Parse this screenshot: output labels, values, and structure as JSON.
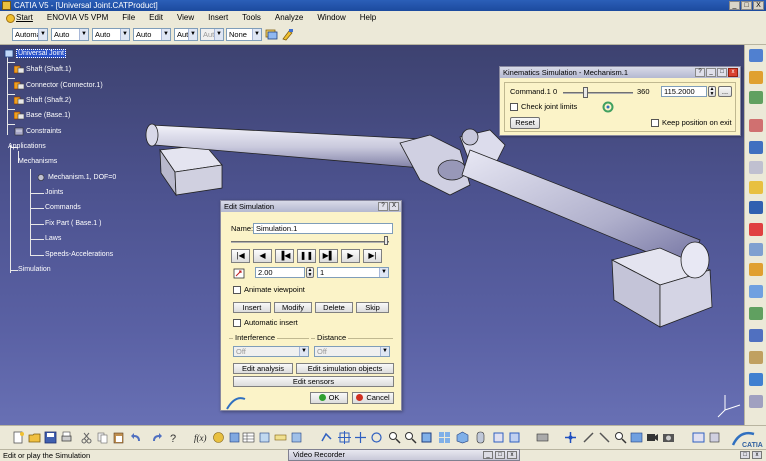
{
  "window": {
    "title": "CATIA V5 - [Universal Joint.CATProduct]",
    "minimize": "_",
    "maximize": "□",
    "close": "X"
  },
  "menu": [
    "Start",
    "ENOVIA V5 VPM",
    "File",
    "Edit",
    "View",
    "Insert",
    "Tools",
    "Analyze",
    "Window",
    "Help"
  ],
  "properties_toolbar": {
    "combos": [
      "Automa",
      "Auto",
      "Auto",
      "Auto",
      "Aut",
      "Aut",
      "None"
    ]
  },
  "tree": {
    "root": "Universal Joint",
    "parts": [
      "Shaft (Shaft.1)",
      "Connector (Connector.1)",
      "Shaft (Shaft.2)",
      "Base (Base.1)"
    ],
    "constraints": "Constraints",
    "applications": "Applications",
    "mechanisms": "Mechanisms",
    "mechanism": "Mechanism.1, DOF=0",
    "mech_children": [
      "Joints",
      "Commands",
      "Fix Part ( Base.1 )",
      "Laws",
      "Speeds-Accelerations"
    ],
    "simulation": "Simulation"
  },
  "kinematics": {
    "title": "Kinematics Simulation - Mechanism.1",
    "command_label": "Command.1",
    "min": "0",
    "max": "360",
    "value": "115.2000",
    "slider_fraction": 0.32,
    "browse": "...",
    "check_limits": "Check joint limits",
    "reset": "Reset",
    "keep_position": "Keep position on exit"
  },
  "editsim": {
    "title": "Edit Simulation",
    "name_label": "Name:",
    "name_value": "Simulation.1",
    "player": [
      "|◀",
      "◀",
      "▐◀",
      "❚❚",
      "▶▌",
      "▶",
      "▶|"
    ],
    "step_value": "2.00",
    "step_select": "1",
    "animate_viewpoint": "Animate viewpoint",
    "insert": "Insert",
    "modify": "Modify",
    "delete": "Delete",
    "skip": "Skip",
    "automatic_insert": "Automatic insert",
    "interference_label": "Interference",
    "interference_value": "Off",
    "distance_label": "Distance",
    "distance_value": "Off",
    "edit_analysis": "Edit analysis",
    "edit_sim_objects": "Edit simulation objects",
    "edit_sensors": "Edit sensors",
    "ok": "OK",
    "cancel": "Cancel",
    "close": "X"
  },
  "status": {
    "text": "Edit or play the Simulation",
    "video_recorder": "Video Recorder"
  },
  "brand": "CATIA",
  "colors": {
    "dialog_bg": "#fbf3c8",
    "viewport": "#4d5390",
    "tree_selection": "#2850c8"
  }
}
